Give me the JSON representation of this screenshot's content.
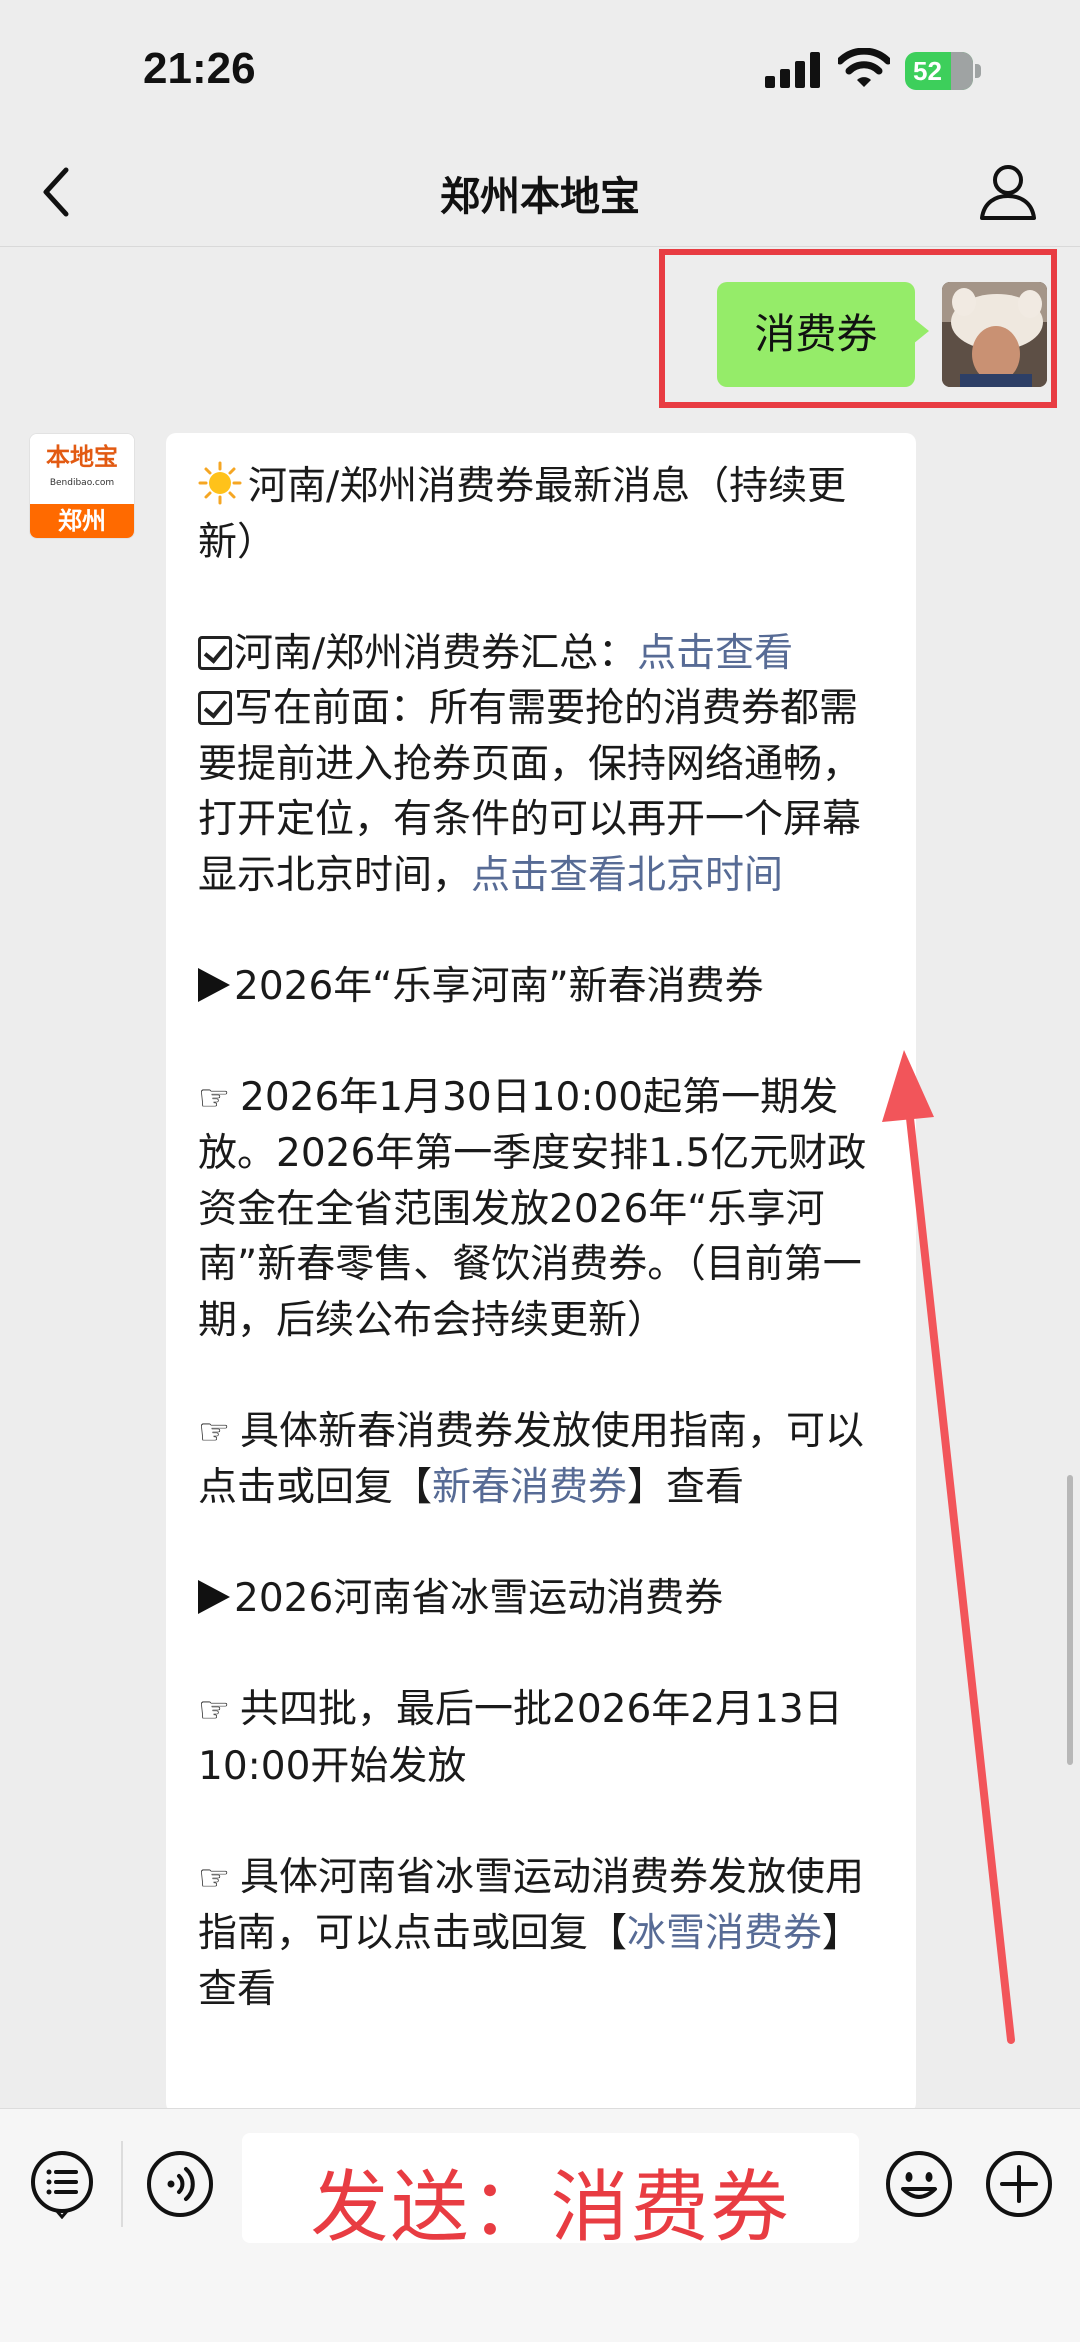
{
  "status_bar": {
    "time": "21:26",
    "battery": "52"
  },
  "nav": {
    "title": "郑州本地宝"
  },
  "outgoing_message": {
    "text": "消费券"
  },
  "bot_avatar": {
    "top": "本地宝",
    "sub": "Bendibao.com",
    "bottom": "郑州"
  },
  "reply": {
    "title": "河南/郑州消费券最新消息（持续更新）",
    "summary_label": "河南/郑州消费券汇总：",
    "summary_link": "点击查看",
    "note_text": "写在前面：所有需要抢的消费券都需要提前进入抢券页面，保持网络通畅，打开定位，有条件的可以再开一个屏幕显示北京时间，",
    "note_link": "点击查看北京时间",
    "section1_title": "2026年“乐享河南”新春消费券",
    "section1_body": "2026年1月30日10:00起第一期发放。2026年第一季度安排1.5亿元财政资金在全省范围发放2026年“乐享河南”新春零售、餐饮消费券。（目前第一期，后续公布会持续更新）",
    "section1_guide_pre": "具体新春消费券发放使用指南，可以点击或回复【",
    "section1_guide_link": "新春消费券",
    "section1_guide_post": "】查看",
    "section2_title": "2026河南省冰雪运动消费券",
    "section2_body": "共四批，最后一批2026年2月13日10:00开始发放",
    "section2_guide_pre": "具体河南省冰雪运动消费券发放使用指南，可以点击或回复【",
    "section2_guide_link": "冰雪消费券",
    "section2_guide_post": "】查看"
  },
  "input_overlay": {
    "text": "发送：消费券"
  },
  "colors": {
    "outgoing_bubble": "#95ec69",
    "link": "#576b95",
    "annotation_red": "#e83c42"
  },
  "icons": [
    "back-icon",
    "profile-icon",
    "sun-icon",
    "checkbox-icon",
    "triangle-icon",
    "pointing-hand-icon",
    "menu-icon",
    "voice-icon",
    "emoji-icon",
    "plus-icon"
  ]
}
